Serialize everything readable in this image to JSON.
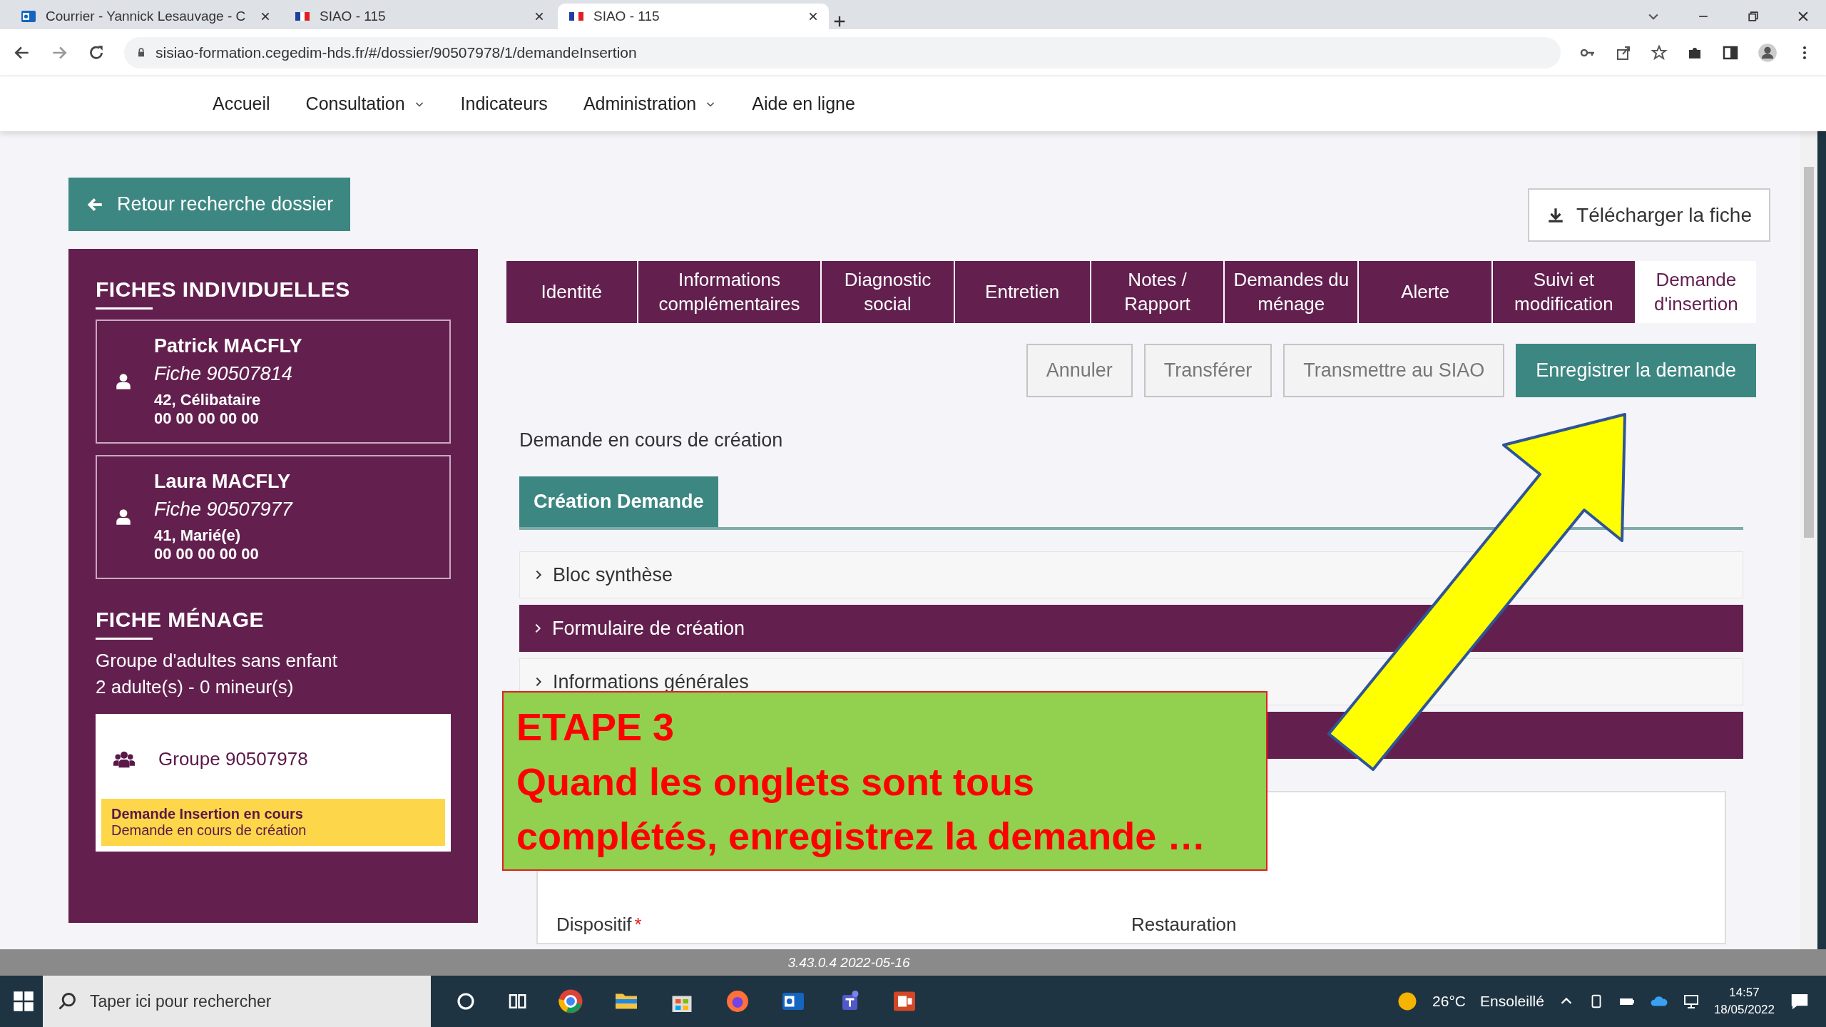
{
  "browser": {
    "tabs": [
      {
        "title": "Courrier - Yannick Lesauvage - C",
        "selected": false,
        "kind": "mail"
      },
      {
        "title": "SIAO - 115",
        "selected": false,
        "kind": "flag"
      },
      {
        "title": "SIAO - 115",
        "selected": true,
        "kind": "flag"
      }
    ],
    "url": "sisiao-formation.cegedim-hds.fr/#/dossier/90507978/1/demandeInsertion"
  },
  "nav": {
    "items": [
      {
        "label": "Accueil",
        "dropdown": false
      },
      {
        "label": "Consultation",
        "dropdown": true
      },
      {
        "label": "Indicateurs",
        "dropdown": false
      },
      {
        "label": "Administration",
        "dropdown": true
      },
      {
        "label": "Aide en ligne",
        "dropdown": false
      }
    ]
  },
  "back_button": "Retour recherche dossier",
  "download_button": "Télécharger la fiche",
  "sidebar": {
    "individual_title": "FICHES INDIVIDUELLES",
    "persons": [
      {
        "name": "Patrick MACFLY",
        "fiche": "Fiche 90507814",
        "details": "42, Célibataire",
        "phone": "00 00 00 00 00"
      },
      {
        "name": "Laura MACFLY",
        "fiche": "Fiche 90507977",
        "details": "41, Marié(e)",
        "phone": "00 00 00 00 00"
      }
    ],
    "household_title": "FICHE MÉNAGE",
    "household_lines": [
      "Groupe d'adultes sans enfant",
      "2 adulte(s) - 0 mineur(s)"
    ],
    "group": {
      "label": "Groupe 90507978",
      "status_title": "Demande Insertion en cours",
      "status_detail": "Demande en cours de création"
    }
  },
  "tabs": [
    {
      "label": "Identité",
      "selected": false
    },
    {
      "label": "Informations complémentaires",
      "selected": false
    },
    {
      "label": "Diagnostic social",
      "selected": false
    },
    {
      "label": "Entretien",
      "selected": false
    },
    {
      "label": "Notes / Rapport",
      "selected": false
    },
    {
      "label": "Demandes du ménage",
      "selected": false
    },
    {
      "label": "Alerte",
      "selected": false
    },
    {
      "label": "Suivi et modification",
      "selected": false
    },
    {
      "label": "Demande d'insertion",
      "selected": true
    }
  ],
  "actions": [
    {
      "label": "Annuler",
      "kind": "secondary"
    },
    {
      "label": "Transférer",
      "kind": "secondary"
    },
    {
      "label": "Transmettre au SIAO",
      "kind": "secondary"
    },
    {
      "label": "Enregistrer la demande",
      "kind": "primary"
    }
  ],
  "status_text": "Demande en cours de création",
  "section_tab": "Création Demande",
  "accordion": [
    {
      "label": "Bloc synthèse",
      "kind": "light"
    },
    {
      "label": "Formulaire de création",
      "kind": "dark"
    },
    {
      "label": "Informations générales",
      "kind": "light"
    },
    {
      "kind": "dark"
    }
  ],
  "form_fields": [
    {
      "label": "Dispositif",
      "required_mark": "*"
    },
    {
      "label": "Restauration"
    }
  ],
  "version": "3.43.0.4 2022-05-16",
  "taskbar": {
    "search_placeholder": "Taper ici pour rechercher",
    "temperature": "26°C",
    "weather": "Ensoleillé",
    "time": "14:57",
    "date": "18/05/2022"
  },
  "annotation": {
    "title": "ETAPE 3",
    "lines": [
      "Quand les onglets sont tous",
      "complétés, enregistrez la demande …"
    ]
  }
}
